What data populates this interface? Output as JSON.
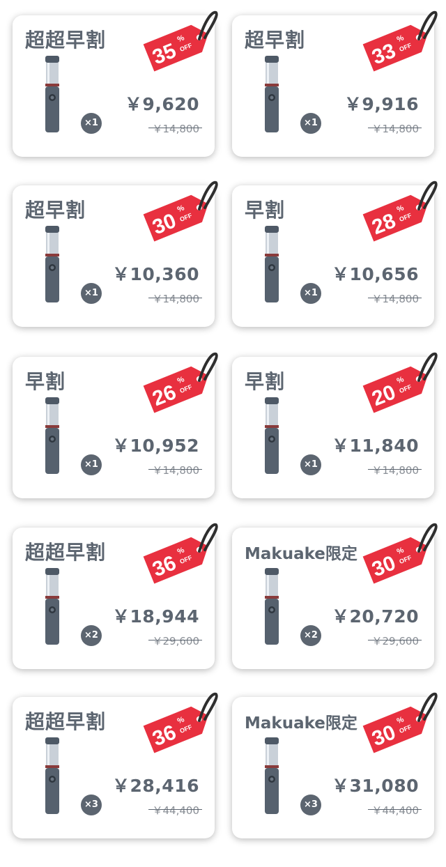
{
  "cards": [
    {
      "title": "超超早割",
      "discount": "35",
      "price": "￥9,620",
      "original": "￥14,800",
      "qty": "×1"
    },
    {
      "title": "超早割",
      "discount": "33",
      "price": "￥9,916",
      "original": "￥14,800",
      "qty": "×1"
    },
    {
      "title": "超早割",
      "discount": "30",
      "price": "￥10,360",
      "original": "￥14,800",
      "qty": "×1"
    },
    {
      "title": "早割",
      "discount": "28",
      "price": "￥10,656",
      "original": "￥14,800",
      "qty": "×1"
    },
    {
      "title": "早割",
      "discount": "26",
      "price": "￥10,952",
      "original": "￥14,800",
      "qty": "×1"
    },
    {
      "title": "早割",
      "discount": "20",
      "price": "￥11,840",
      "original": "￥14,800",
      "qty": "×1"
    },
    {
      "title": "超超早割",
      "discount": "36",
      "price": "￥18,944",
      "original": "￥29,600",
      "qty": "×2"
    },
    {
      "title": "Makuake限定",
      "discount": "30",
      "price": "￥20,720",
      "original": "￥29,600",
      "qty": "×2"
    },
    {
      "title": "超超早割",
      "discount": "36",
      "price": "￥28,416",
      "original": "￥44,400",
      "qty": "×3"
    },
    {
      "title": "Makuake限定",
      "discount": "30",
      "price": "￥31,080",
      "original": "￥44,400",
      "qty": "×3"
    }
  ],
  "tag_suffix_percent": "%",
  "tag_suffix_off": "OFF",
  "colors": {
    "tag": "#e8303f",
    "text": "#5c6570",
    "badge": "#5c6570"
  },
  "icons": {
    "product": "product-device-icon",
    "tag": "price-tag-icon"
  }
}
